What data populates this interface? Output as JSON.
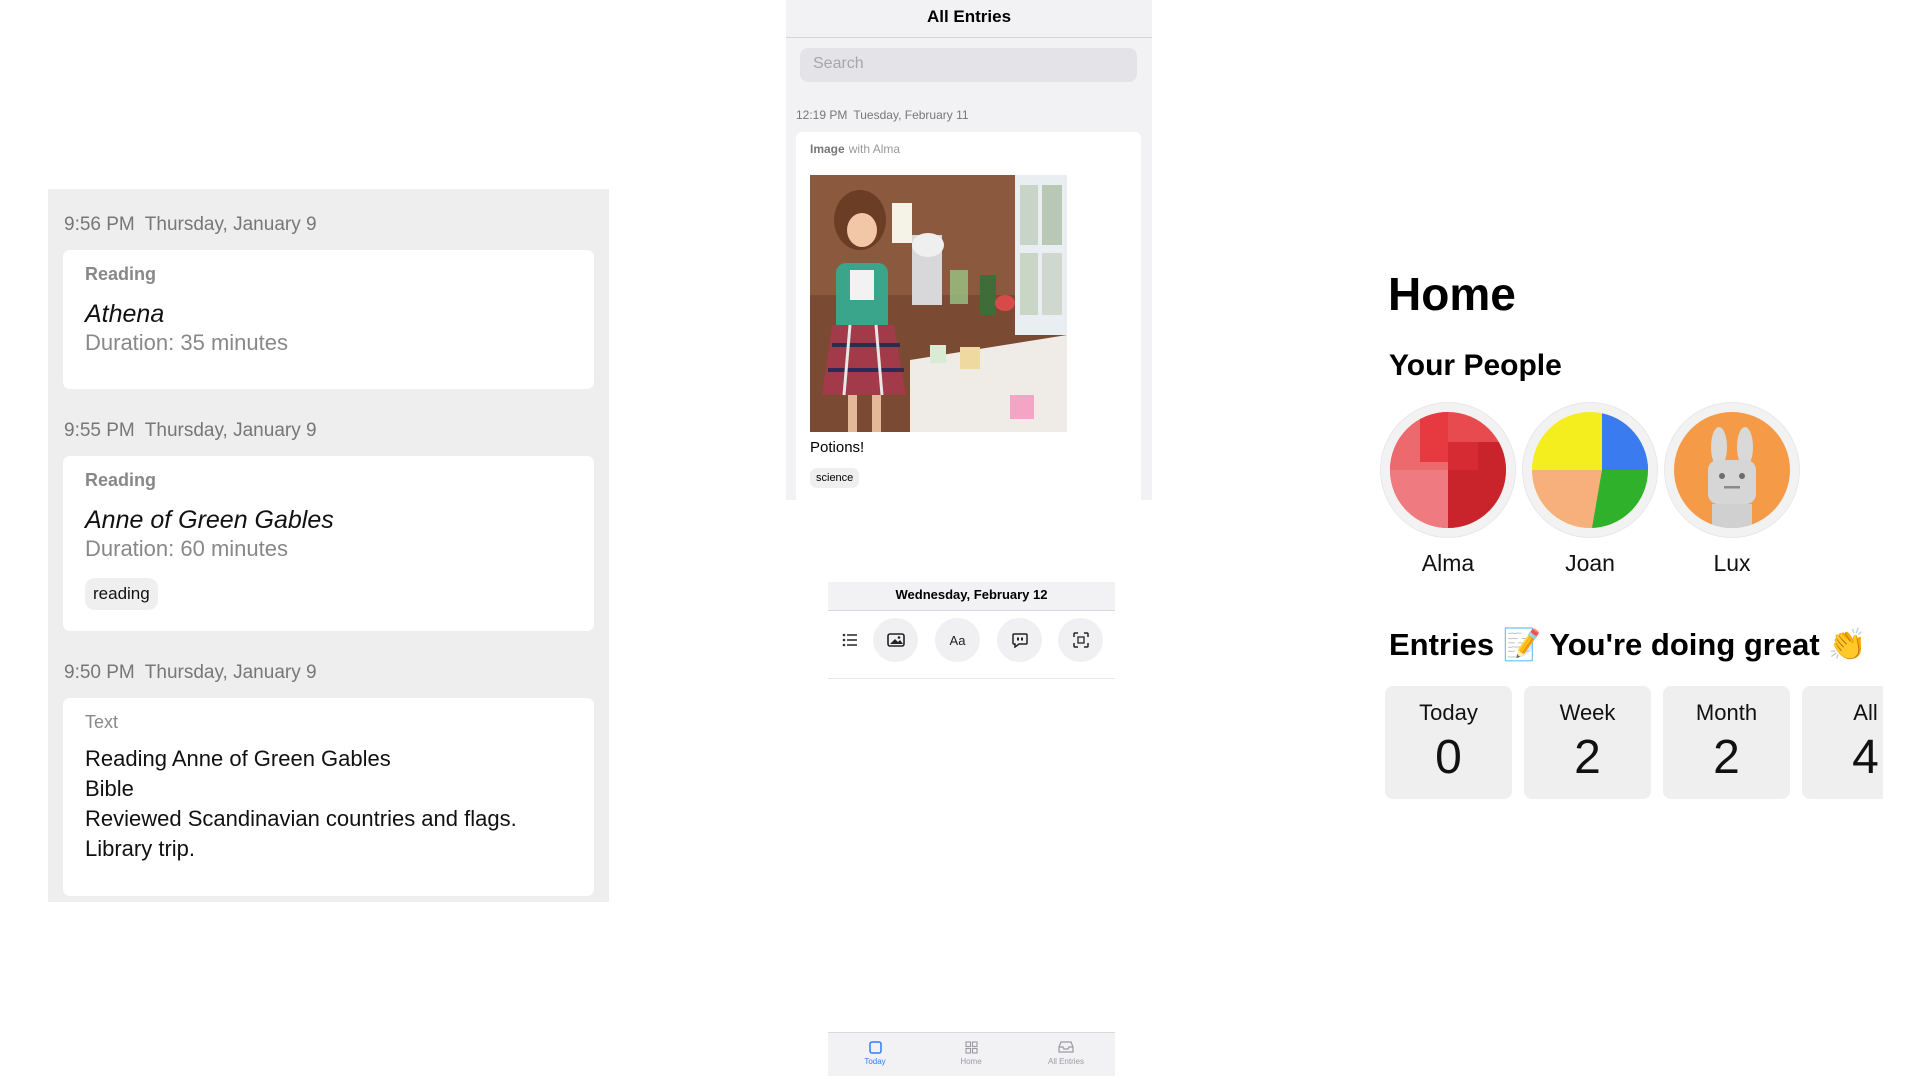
{
  "journal": {
    "entries": [
      {
        "time": "9:56 PM",
        "date": "Thursday, January 9",
        "type": "Reading",
        "title": "Athena",
        "duration": "Duration: 35 minutes"
      },
      {
        "time": "9:55 PM",
        "date": "Thursday, January 9",
        "type": "Reading",
        "title": "Anne of Green Gables",
        "duration": "Duration: 60 minutes",
        "tag": "reading"
      },
      {
        "time": "9:50 PM",
        "date": "Thursday, January 9",
        "type": "Text",
        "lines": [
          "Reading Anne of Green Gables",
          "Bible",
          "Reviewed Scandinavian countries and flags.",
          "Library trip."
        ]
      }
    ]
  },
  "all_entries": {
    "title": "All Entries",
    "search_placeholder": "Search",
    "entry": {
      "time": "12:19 PM",
      "date": "Tuesday, February 11",
      "kind": "Image",
      "with": "with Alma",
      "caption": "Potions!",
      "tag": "science"
    }
  },
  "today": {
    "date": "Wednesday, February 12",
    "tools": [
      {
        "icon": "list-icon"
      },
      {
        "icon": "photo-icon"
      },
      {
        "label": "Aa",
        "icon": "text-icon"
      },
      {
        "icon": "quote-bubble-icon"
      },
      {
        "icon": "scan-icon"
      }
    ],
    "tabs": [
      {
        "label": "Today",
        "icon": "today-icon",
        "active": true
      },
      {
        "label": "Home",
        "icon": "grid-icon",
        "active": false
      },
      {
        "label": "All Entries",
        "icon": "tray-icon",
        "active": false
      }
    ]
  },
  "home": {
    "title": "Home",
    "people_title": "Your People",
    "people": [
      {
        "name": "Alma",
        "avatar": "red-blocks-avatar"
      },
      {
        "name": "Joan",
        "avatar": "colorful-blocks-avatar"
      },
      {
        "name": "Lux",
        "avatar": "bunny-avatar"
      }
    ],
    "entries_title": "Entries 📝 You're doing great 👏",
    "stats": [
      {
        "label": "Today",
        "value": "0"
      },
      {
        "label": "Week",
        "value": "2"
      },
      {
        "label": "Month",
        "value": "2"
      },
      {
        "label": "All",
        "value": "4"
      }
    ]
  },
  "colors": {
    "accent": "#2f7df6",
    "panel_bg": "#eeeeef",
    "card_bg": "#ffffff"
  }
}
